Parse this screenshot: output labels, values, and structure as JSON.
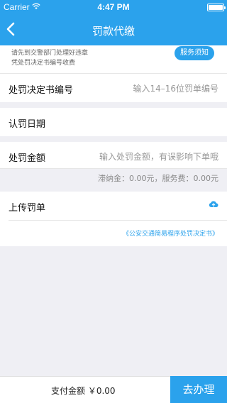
{
  "status_bar": {
    "carrier": "Carrier",
    "time": "4:47 PM"
  },
  "nav": {
    "title": "罚款代缴"
  },
  "notice": {
    "line1": "请先到交警部门处理好违章",
    "line2": "凭处罚决定书编号收费",
    "button": "服务须知"
  },
  "form": {
    "decision_number": {
      "label": "处罚决定书编号",
      "placeholder": "输入14–16位罚单编号"
    },
    "date": {
      "label": "认罚日期"
    },
    "amount": {
      "label": "处罚金额",
      "placeholder": "输入处罚金额，有误影响下单哦"
    },
    "fees": "滞纳金：0.00元，服务费：0.00元",
    "upload": {
      "label": "上传罚单",
      "link": "《公安交通简易程序处罚决定书》"
    }
  },
  "bottom": {
    "total": "支付金额 ￥0.00",
    "submit": "去办理"
  },
  "colors": {
    "accent": "#2ba2ec",
    "background": "#efeff4"
  },
  "icons": {
    "back": "chevron-left-icon",
    "wifi": "wifi-icon",
    "battery": "battery-icon",
    "upload": "cloud-upload-icon"
  }
}
